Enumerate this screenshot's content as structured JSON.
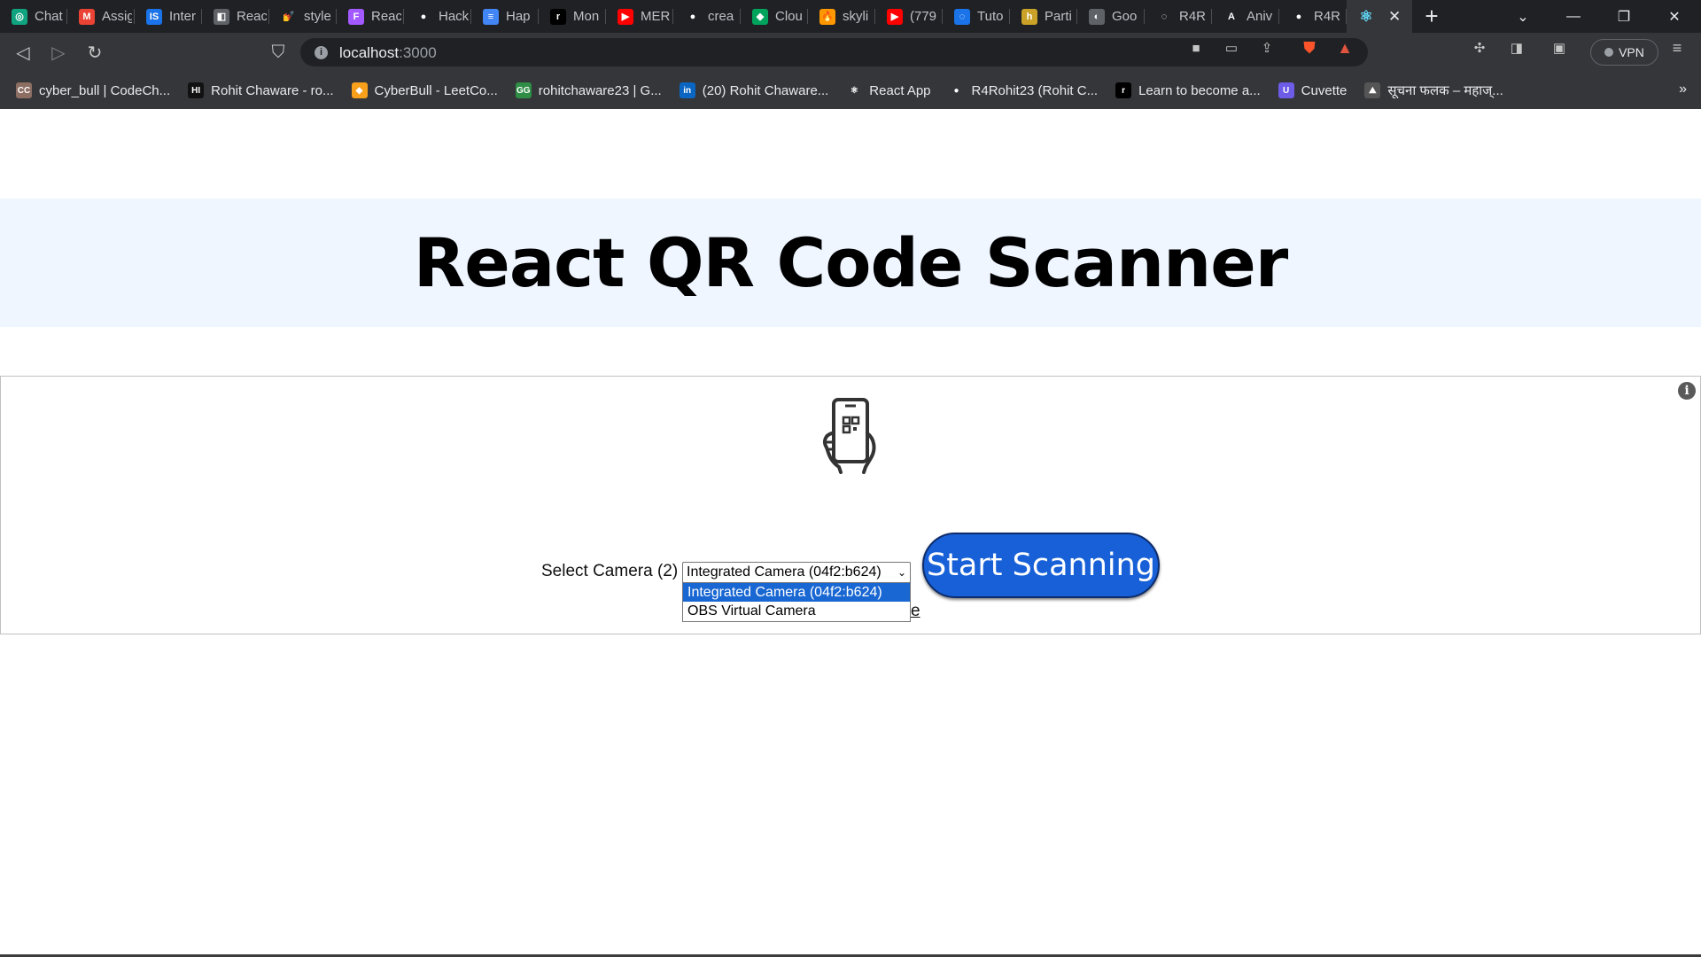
{
  "tabs": [
    {
      "title": "Chat",
      "color": "#10a37f",
      "glyph": "◎"
    },
    {
      "title": "Assig",
      "color": "#ea4335",
      "glyph": "M"
    },
    {
      "title": "Inter",
      "color": "#1a73e8",
      "glyph": "IS"
    },
    {
      "title": "Reac",
      "color": "#5f6368",
      "glyph": "◧"
    },
    {
      "title": "style",
      "color": "#202124",
      "glyph": "💅"
    },
    {
      "title": "Reac",
      "color": "#a259ff",
      "glyph": "F"
    },
    {
      "title": "Hack",
      "color": "#202124",
      "glyph": "●"
    },
    {
      "title": "Hap",
      "color": "#4285f4",
      "glyph": "≡"
    },
    {
      "title": "Mon",
      "color": "#000000",
      "glyph": "r"
    },
    {
      "title": "MER",
      "color": "#ff0000",
      "glyph": "▶"
    },
    {
      "title": "crea",
      "color": "#202124",
      "glyph": "●"
    },
    {
      "title": "Clou",
      "color": "#00a35c",
      "glyph": "◆"
    },
    {
      "title": "skyli",
      "color": "#ff9800",
      "glyph": "🔥"
    },
    {
      "title": "(779",
      "color": "#ff0000",
      "glyph": "▶"
    },
    {
      "title": "Tuto",
      "color": "#1a73e8",
      "glyph": "◌"
    },
    {
      "title": "Parti",
      "color": "#c9a227",
      "glyph": "h"
    },
    {
      "title": "Goo",
      "color": "#5f6368",
      "glyph": "◐"
    },
    {
      "title": "R4R",
      "color": "#202124",
      "glyph": "◌"
    },
    {
      "title": "Aniv",
      "color": "#202124",
      "glyph": "A"
    },
    {
      "title": "R4R",
      "color": "#202124",
      "glyph": "●"
    }
  ],
  "active_tab": {
    "glyph": "⚛",
    "close": "✕"
  },
  "window_controls": {
    "new_tab": "+",
    "list": "⌄",
    "minimize": "—",
    "restore": "❐",
    "close": "✕"
  },
  "address_bar": {
    "host": "localhost",
    "port": ":3000"
  },
  "vpn_label": "VPN",
  "bookmarks": [
    {
      "label": "cyber_bull | CodeCh...",
      "color": "#8d6e63",
      "glyph": "CC"
    },
    {
      "label": "Rohit Chaware - ro...",
      "color": "#111111",
      "glyph": "HI"
    },
    {
      "label": "CyberBull - LeetCo...",
      "color": "#f89f1b",
      "glyph": "◆"
    },
    {
      "label": "rohitchaware23 | G...",
      "color": "#2f8d46",
      "glyph": "GG"
    },
    {
      "label": "(20) Rohit Chaware...",
      "color": "#0a66c2",
      "glyph": "in"
    },
    {
      "label": "React App",
      "color": "#35363a",
      "glyph": "⚛"
    },
    {
      "label": "R4Rohit23 (Rohit C...",
      "color": "#35363a",
      "glyph": "●"
    },
    {
      "label": "Learn to become a...",
      "color": "#000000",
      "glyph": "r"
    },
    {
      "label": "Cuvette",
      "color": "#6c5ce7",
      "glyph": "U"
    },
    {
      "label": "सूचना फलक – महाज्...",
      "color": "#555555",
      "glyph": "⛰"
    }
  ],
  "bookmarks_more": "»",
  "page": {
    "title": "React QR Code Scanner",
    "info_icon": "i",
    "camera_label": "Select Camera (2)",
    "camera_selected": "Integrated Camera (04f2:b624)",
    "camera_options": [
      "Integrated Camera (04f2:b624)",
      "OBS Virtual Camera"
    ],
    "link_fragment": "e",
    "start_button": "Start Scanning"
  }
}
